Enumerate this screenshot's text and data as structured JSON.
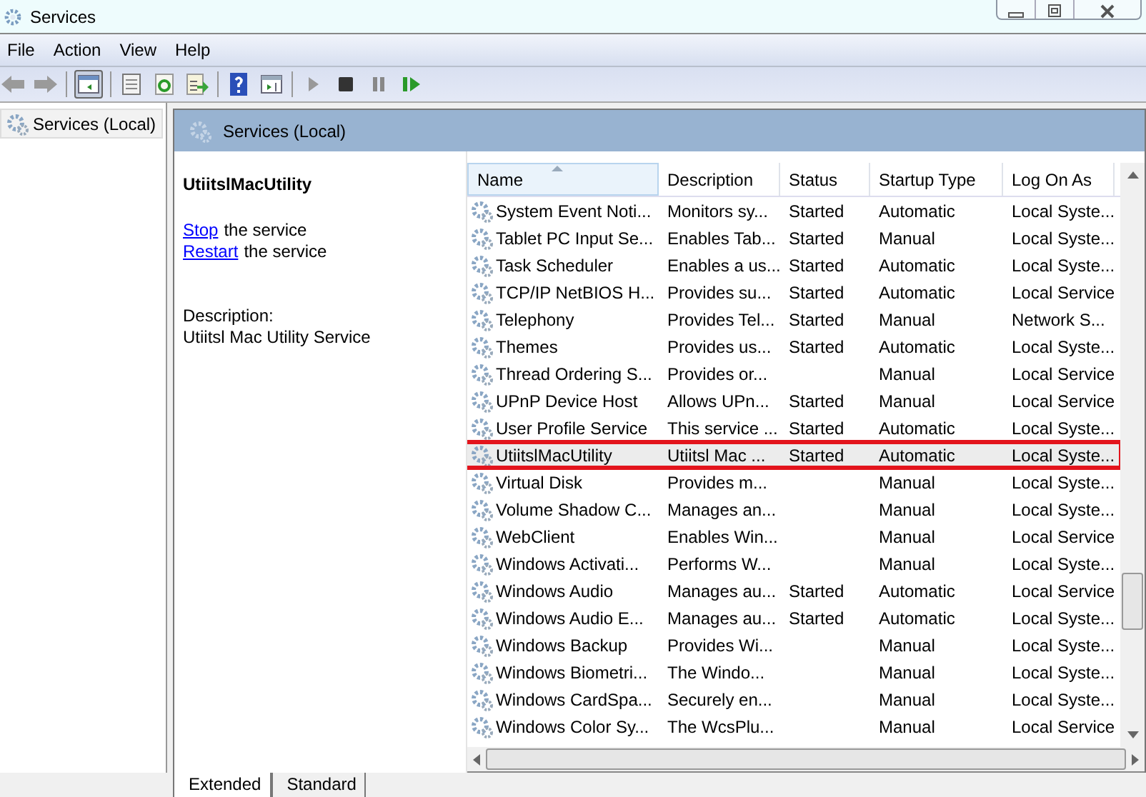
{
  "window": {
    "title": "Services"
  },
  "menu": [
    "File",
    "Action",
    "View",
    "Help"
  ],
  "tree": {
    "items": [
      {
        "label": "Services (Local)",
        "selected": true
      }
    ]
  },
  "panel_header": "Services (Local)",
  "details": {
    "name": "UtiitslMacUtility",
    "actions": [
      {
        "link": "Stop",
        "text": "the service"
      },
      {
        "link": "Restart",
        "text": "the service"
      }
    ],
    "description_label": "Description:",
    "description": "Utiitsl Mac Utility Service"
  },
  "table": {
    "columns": [
      "Name",
      "Description",
      "Status",
      "Startup Type",
      "Log On As"
    ],
    "rows": [
      {
        "cells": [
          "System Event Noti...",
          "Monitors sy...",
          "Started",
          "Automatic",
          "Local Syste..."
        ],
        "selected": false,
        "marked": false
      },
      {
        "cells": [
          "Tablet PC Input Se...",
          "Enables Tab...",
          "Started",
          "Manual",
          "Local Syste..."
        ],
        "selected": false,
        "marked": false
      },
      {
        "cells": [
          "Task Scheduler",
          "Enables a us...",
          "Started",
          "Automatic",
          "Local Syste..."
        ],
        "selected": false,
        "marked": false
      },
      {
        "cells": [
          "TCP/IP NetBIOS H...",
          "Provides su...",
          "Started",
          "Automatic",
          "Local Service"
        ],
        "selected": false,
        "marked": false
      },
      {
        "cells": [
          "Telephony",
          "Provides Tel...",
          "Started",
          "Manual",
          "Network S..."
        ],
        "selected": false,
        "marked": false
      },
      {
        "cells": [
          "Themes",
          "Provides us...",
          "Started",
          "Automatic",
          "Local Syste..."
        ],
        "selected": false,
        "marked": false
      },
      {
        "cells": [
          "Thread Ordering S...",
          "Provides or...",
          "",
          "Manual",
          "Local Service"
        ],
        "selected": false,
        "marked": false
      },
      {
        "cells": [
          "UPnP Device Host",
          "Allows UPn...",
          "Started",
          "Manual",
          "Local Service"
        ],
        "selected": false,
        "marked": false
      },
      {
        "cells": [
          "User Profile Service",
          "This service ...",
          "Started",
          "Automatic",
          "Local Syste..."
        ],
        "selected": false,
        "marked": false
      },
      {
        "cells": [
          "UtiitslMacUtility",
          "Utiitsl Mac ...",
          "Started",
          "Automatic",
          "Local Syste..."
        ],
        "selected": true,
        "marked": true
      },
      {
        "cells": [
          "Virtual Disk",
          "Provides m...",
          "",
          "Manual",
          "Local Syste..."
        ],
        "selected": false,
        "marked": false
      },
      {
        "cells": [
          "Volume Shadow C...",
          "Manages an...",
          "",
          "Manual",
          "Local Syste..."
        ],
        "selected": false,
        "marked": false
      },
      {
        "cells": [
          "WebClient",
          "Enables Win...",
          "",
          "Manual",
          "Local Service"
        ],
        "selected": false,
        "marked": false
      },
      {
        "cells": [
          "Windows Activati...",
          "Performs W...",
          "",
          "Manual",
          "Local Syste..."
        ],
        "selected": false,
        "marked": false
      },
      {
        "cells": [
          "Windows Audio",
          "Manages au...",
          "Started",
          "Automatic",
          "Local Service"
        ],
        "selected": false,
        "marked": false
      },
      {
        "cells": [
          "Windows Audio E...",
          "Manages au...",
          "Started",
          "Automatic",
          "Local Syste..."
        ],
        "selected": false,
        "marked": false
      },
      {
        "cells": [
          "Windows Backup",
          "Provides Wi...",
          "",
          "Manual",
          "Local Syste..."
        ],
        "selected": false,
        "marked": false
      },
      {
        "cells": [
          "Windows Biometri...",
          "The Windo...",
          "",
          "Manual",
          "Local Syste..."
        ],
        "selected": false,
        "marked": false
      },
      {
        "cells": [
          "Windows CardSpa...",
          "Securely en...",
          "",
          "Manual",
          "Local Syste..."
        ],
        "selected": false,
        "marked": false
      },
      {
        "cells": [
          "Windows Color Sy...",
          "The WcsPlu...",
          "",
          "Manual",
          "Local Service"
        ],
        "selected": false,
        "marked": false
      }
    ]
  },
  "tabs": [
    {
      "label": "Extended",
      "selected": true
    },
    {
      "label": "Standard",
      "selected": false
    }
  ]
}
